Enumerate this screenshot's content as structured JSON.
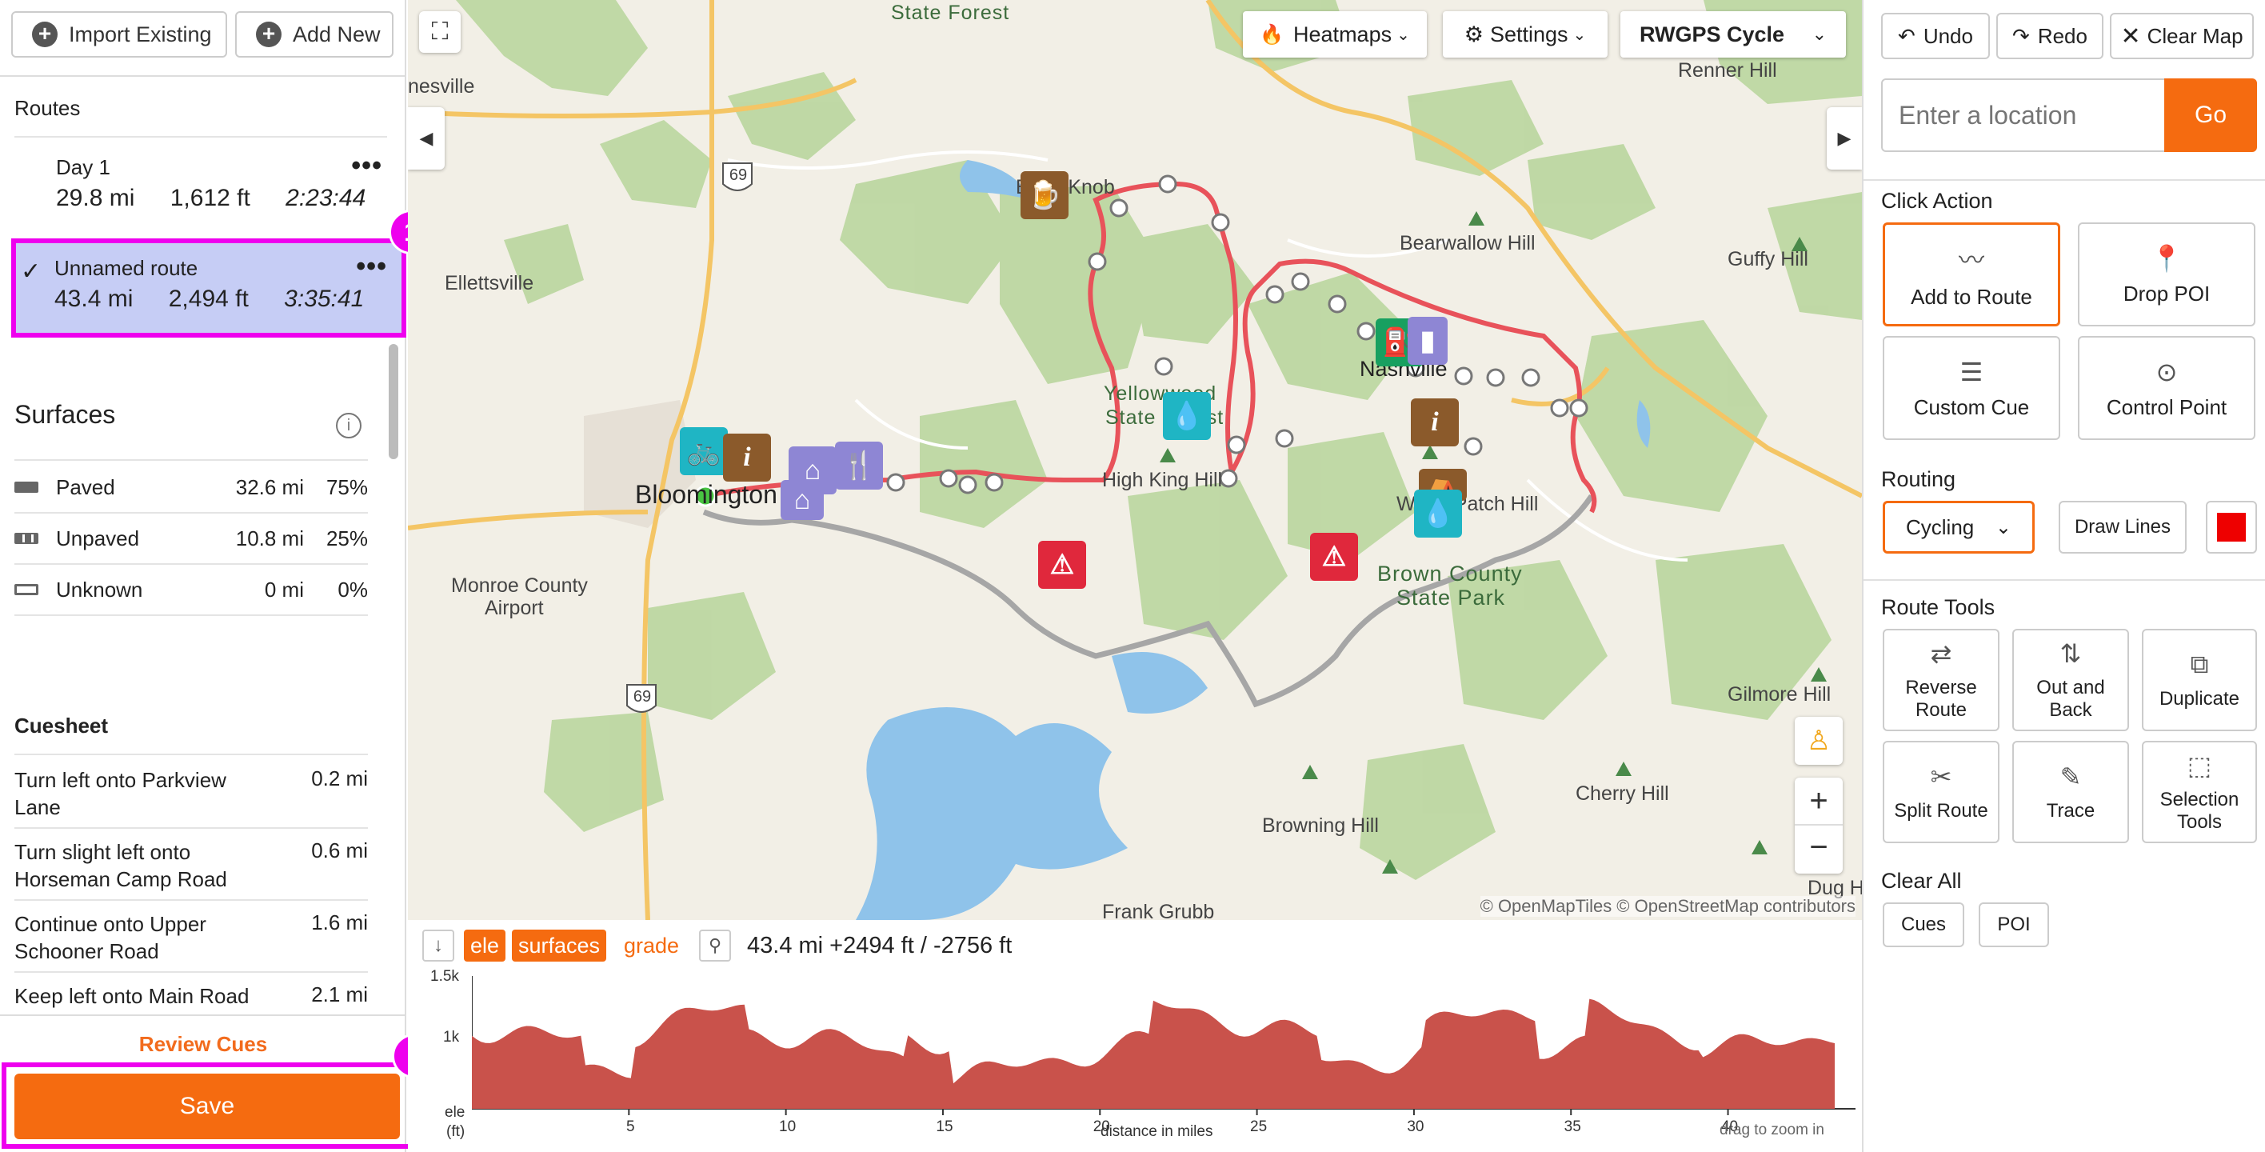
{
  "left_panel": {
    "import_label": "Import Existing",
    "add_new_label": "Add New",
    "routes_header": "Routes",
    "routes": [
      {
        "name": "Day 1",
        "distance": "29.8 mi",
        "elevation": "1,612 ft",
        "time": "2:23:44"
      },
      {
        "name": "Unnamed route",
        "distance": "43.4 mi",
        "elevation": "2,494 ft",
        "time": "3:35:41",
        "selected": true
      }
    ],
    "surfaces_header": "Surfaces",
    "surfaces": [
      {
        "label": "Paved",
        "distance": "32.6 mi",
        "percent": "75%"
      },
      {
        "label": "Unpaved",
        "distance": "10.8 mi",
        "percent": "25%"
      },
      {
        "label": "Unknown",
        "distance": "0 mi",
        "percent": "0%"
      }
    ],
    "cuesheet_header": "Cuesheet",
    "cues": [
      {
        "text": "Turn left onto Parkview Lane",
        "distance": "0.2 mi"
      },
      {
        "text": "Turn slight left onto Horseman Camp Road",
        "distance": "0.6 mi"
      },
      {
        "text": "Continue onto Upper Schooner Road",
        "distance": "1.6 mi"
      },
      {
        "text": "Keep left onto Main Road",
        "distance": "2.1 mi"
      }
    ],
    "review_cues_label": "Review Cues",
    "save_label": "Save",
    "badge_1": "1",
    "badge_2": "2"
  },
  "map": {
    "heatmaps_label": "Heatmaps",
    "settings_label": "Settings",
    "layer_label": "RWGPS Cycle",
    "attribution": "© OpenMapTiles © OpenStreetMap contributors",
    "labels": {
      "state_forest_top": "State Forest",
      "renner_hill": "Renner Hill",
      "nesville": "nesville",
      "ellettsville": "Ellettsville",
      "bearwallow": "Bearwallow Hill",
      "guffy": "Guffy Hill",
      "yellowwood_1": "Yellowwood",
      "yellowwood_2": "State Forest",
      "high_king": "High King Hill",
      "nashville": "Nashville",
      "bloomington": "Bloomington",
      "monroe_1": "Monroe County",
      "monroe_2": "Airport",
      "weed_patch": "Weed Patch Hill",
      "brown_county_1": "Brown County",
      "brown_county_2": "State Park",
      "gilmore": "Gilmore Hill",
      "cherry": "Cherry Hill",
      "browning": "Browning Hill",
      "frank_grubb": "Frank Grubb",
      "dug": "Dug H",
      "bean_knob": "Bean Knob",
      "hwy69_a": "69",
      "hwy69_b": "69"
    }
  },
  "elevation": {
    "tag_ele": "ele",
    "tag_surfaces": "surfaces",
    "tag_grade": "grade",
    "summary": "43.4 mi +2494 ft / -2756 ft",
    "y_ticks": [
      "1.5k",
      "1k"
    ],
    "y_label_1": "ele",
    "y_label_2": "(ft)",
    "x_ticks": [
      "5",
      "10",
      "15",
      "20",
      "25",
      "30",
      "35",
      "40"
    ],
    "x_label": "distance in miles",
    "zoom_hint": "drag to zoom in",
    "profile_color": "#c9524b"
  },
  "right_panel": {
    "undo_label": "Undo",
    "redo_label": "Redo",
    "clear_map_label": "Clear Map",
    "location_placeholder": "Enter a location",
    "go_label": "Go",
    "click_action_header": "Click Action",
    "click_actions": [
      "Add to Route",
      "Drop POI",
      "Custom Cue",
      "Control Point"
    ],
    "routing_header": "Routing",
    "routing_mode": "Cycling",
    "draw_lines_label": "Draw Lines",
    "route_color": "#ee0000",
    "route_tools_header": "Route Tools",
    "route_tools": [
      "Reverse Route",
      "Out and Back",
      "Duplicate",
      "Split Route",
      "Trace",
      "Selection Tools"
    ],
    "clear_all_header": "Clear All",
    "clear_cues_label": "Cues",
    "clear_poi_label": "POI"
  },
  "colors": {
    "accent": "#f56b10",
    "highlight": "#ee00ee",
    "selected_route_bg": "#c6cdf5",
    "route_line": "#e8525a"
  }
}
